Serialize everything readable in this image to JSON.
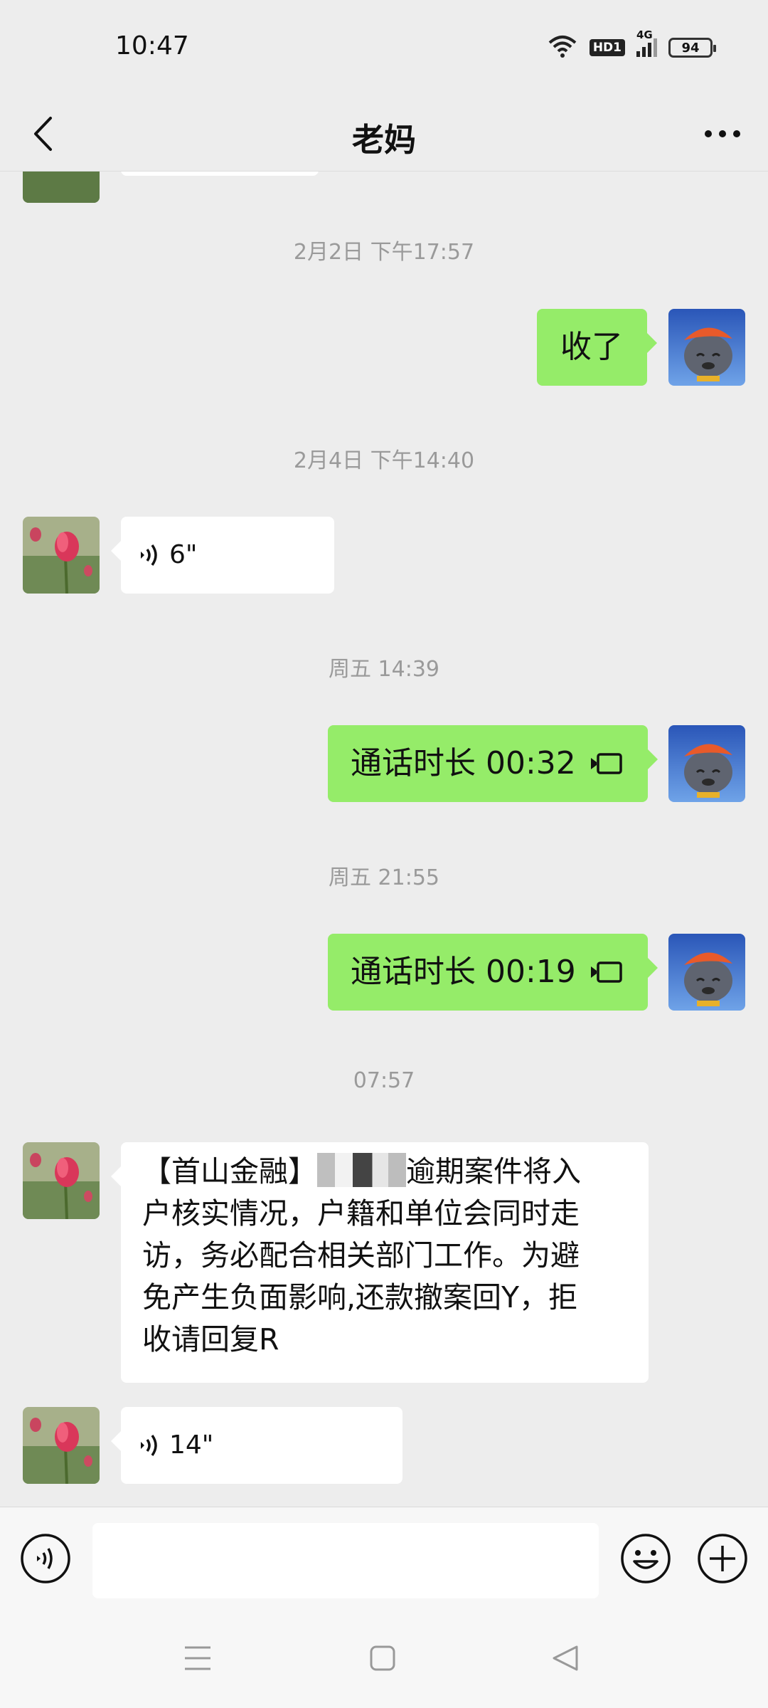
{
  "status_bar": {
    "time": "10:47",
    "network": "4G",
    "hd": "HD1",
    "battery": "94"
  },
  "header": {
    "title": "老妈"
  },
  "messages": [
    {
      "type": "timestamp",
      "text": "2月2日 下午17:57"
    },
    {
      "type": "text",
      "side": "out",
      "text": "收了"
    },
    {
      "type": "timestamp",
      "text": "2月4日 下午14:40"
    },
    {
      "type": "voice",
      "side": "in",
      "duration": "6\""
    },
    {
      "type": "timestamp",
      "text": "周五 14:39"
    },
    {
      "type": "call",
      "side": "out",
      "text": "通话时长 00:32"
    },
    {
      "type": "timestamp",
      "text": "周五 21:55"
    },
    {
      "type": "call",
      "side": "out",
      "text": "通话时长 00:19"
    },
    {
      "type": "timestamp",
      "text": "07:57"
    },
    {
      "type": "text",
      "side": "in",
      "lines": [
        "【首山金融】",
        "逾期案件将入",
        "户核实情况，户籍和单位会同时走",
        "访，务必配合相关部门工作。为避",
        "免产生负面影响,还款撤案回Y，拒",
        "收请回复R"
      ]
    },
    {
      "type": "voice",
      "side": "in",
      "duration": "14\""
    }
  ],
  "input_bar": {
    "placeholder": ""
  },
  "colors": {
    "background": "#ededed",
    "outgoing_bubble": "#95ec69",
    "incoming_bubble": "#ffffff",
    "timestamp": "#9a9a9a"
  },
  "icons": [
    "back-icon",
    "more-icon",
    "voice-input-icon",
    "emoji-icon",
    "plus-icon",
    "menu-icon",
    "home-icon",
    "back-nav-icon",
    "video-call-icon",
    "voice-wave-icon"
  ]
}
